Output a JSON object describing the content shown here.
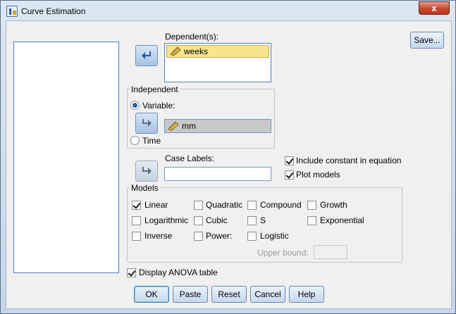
{
  "window": {
    "title": "Curve Estimation",
    "close_label": "x"
  },
  "dependent": {
    "label": "Dependent(s):",
    "items": [
      "weeks"
    ]
  },
  "independent": {
    "group_label": "Independent",
    "variable_label": "Variable:",
    "variable_value": "mm",
    "time_label": "Time",
    "mode_selected": "Variable"
  },
  "case_labels": {
    "label": "Case Labels:",
    "value": ""
  },
  "options": {
    "include_constant": "Include constant in equation",
    "include_constant_checked": true,
    "plot_models": "Plot models",
    "plot_models_checked": true
  },
  "models": {
    "group_label": "Models",
    "linear": "Linear",
    "quadratic": "Quadratic",
    "compound": "Compound",
    "growth": "Growth",
    "logarithmic": "Logarithmic",
    "cubic": "Cubic",
    "s": "S",
    "exponential": "Exponential",
    "inverse": "Inverse",
    "power": "Power:",
    "logistic": "Logistic",
    "upper_bound": "Upper bound:",
    "checked": [
      "Linear"
    ]
  },
  "display_anova": {
    "label": "Display ANOVA table",
    "checked": true
  },
  "buttons": {
    "save": "Save...",
    "ok": "OK",
    "paste": "Paste",
    "reset": "Reset",
    "cancel": "Cancel",
    "help": "Help"
  },
  "colors": {
    "selection": "#f8e48f",
    "accent": "#4a7fbf",
    "close": "#c7462f"
  }
}
